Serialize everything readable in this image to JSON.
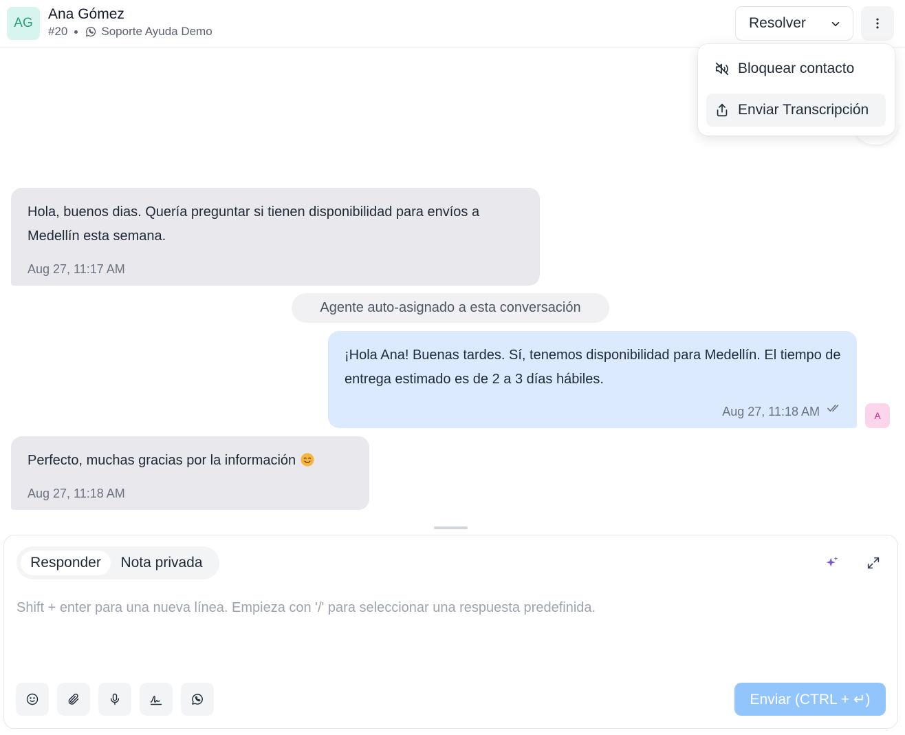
{
  "header": {
    "avatar_initials": "AG",
    "contact_name": "Ana Gómez",
    "conversation_id": "#20",
    "inbox_name": "Soporte Ayuda Demo",
    "resolve_label": "Resolver"
  },
  "menu": {
    "items": [
      {
        "label": "Bloquear contacto",
        "icon": "mute-icon"
      },
      {
        "label": "Enviar Transcripción",
        "icon": "share-icon"
      }
    ]
  },
  "messages": [
    {
      "direction": "incoming",
      "text": "Hola, buenos dias. Quería preguntar si tienen disponibilidad para envíos a Medellín esta semana.",
      "time": "Aug 27, 11:17 AM"
    },
    {
      "direction": "activity",
      "text": "Agente auto-asignado a esta conversación"
    },
    {
      "direction": "outgoing",
      "text": "¡Hola Ana! Buenas tardes. Sí, tenemos disponibilidad para Medellín. El tiempo de entrega estimado es de 2 a 3 días hábiles.",
      "time": "Aug 27, 11:18 AM",
      "agent_initial": "A"
    },
    {
      "direction": "incoming",
      "text": "Perfecto, muchas gracias por la información",
      "time": "Aug 27, 11:18 AM"
    }
  ],
  "composer": {
    "tabs": [
      "Responder",
      "Nota privada"
    ],
    "active_tab": "Responder",
    "placeholder": "Shift + enter para una nueva línea. Empieza con '/' para seleccionar una respuesta predefinida.",
    "value": "",
    "send_label": "Enviar (CTRL + ↵)",
    "tools": [
      "emoji-icon",
      "attachment-icon",
      "microphone-icon",
      "signature-icon",
      "whatsapp-icon"
    ]
  },
  "colors": {
    "incoming_bubble": "#e8e8ed",
    "outgoing_bubble": "#dbeafe",
    "send_button": "#93c5fd",
    "accent_sparkle": "#7c5cd6",
    "avatar_bg": "#d7f5ee"
  }
}
